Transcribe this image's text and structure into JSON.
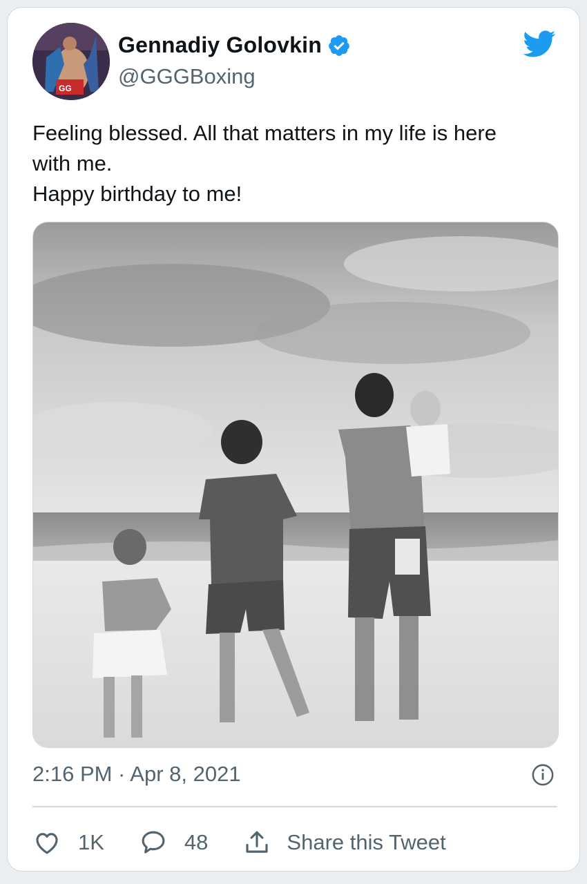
{
  "tweet": {
    "display_name": "Gennadiy Golovkin",
    "handle": "@GGGBoxing",
    "verified": true,
    "text_lines": [
      "Feeling blessed. All that matters in my life is here",
      "with me.",
      "Happy birthday to me!"
    ],
    "timestamp": "2:16 PM · Apr 8, 2021",
    "avatar_badge_text": "GG"
  },
  "actions": {
    "likes": "1K",
    "replies": "48",
    "share_label": "Share this Tweet"
  },
  "icons": {
    "brand": "twitter-bird-icon",
    "verified": "verified-badge-icon",
    "info": "info-icon",
    "like": "heart-icon",
    "reply": "reply-bubble-icon",
    "share": "share-icon"
  },
  "colors": {
    "brand_blue": "#1d9bf0",
    "text_primary": "#0f1419",
    "text_secondary": "#536471",
    "border": "#cfd9de"
  }
}
